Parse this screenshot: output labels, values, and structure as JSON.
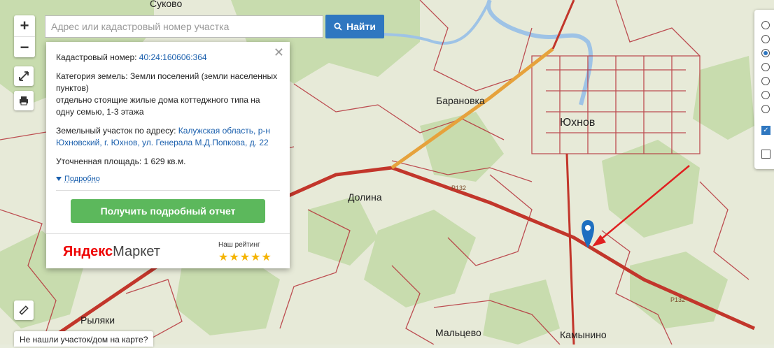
{
  "search": {
    "placeholder": "Адрес или кадастровый номер участка",
    "button_label": "Найти"
  },
  "zoom": {
    "plus": "+",
    "minus": "−"
  },
  "panel": {
    "cad_label": "Кадастровый номер:",
    "cad_number": "40:24:160606:364",
    "category_label": "Категория земель:",
    "category_value": "Земли поселений (земли населенных пунктов)",
    "use_value": "отдельно стоящие жилые дома коттеджного типа на одну семью, 1-3 этажа",
    "address_label": "Земельный участок по адресу:",
    "address_value": "Калужская область, р-н Юхновский, г. Юхнов, ул. Генерала М.Д.Попкова, д. 22",
    "area_label": "Уточненная площадь:",
    "area_value": "1 629 кв.м.",
    "more_label": "Подробно",
    "report_button": "Получить подробный отчет",
    "market_logo_red": "Яндекс",
    "market_logo_grey": "Маркет",
    "rating_label": "Наш рейтинг",
    "stars": "★★★★★"
  },
  "map_labels": {
    "barannovka": "Барановка",
    "yukhnov": "Юхнов",
    "dolina": "Долина",
    "malcevo": "Мальцево",
    "kamynino": "Камынино",
    "ryljaki": "Рыляки",
    "sukovo": "Суково",
    "road_a": "Р132",
    "road_b": "Р132"
  },
  "layers": {
    "radios": [
      false,
      false,
      true,
      false,
      false,
      false,
      false
    ],
    "checks": [
      true,
      false
    ]
  },
  "footer": {
    "not_found": "Не нашли участок/дом на карте?"
  },
  "colors": {
    "accent": "#2f77c0",
    "green_button": "#5cb85c",
    "boundary": "#b22222",
    "marker": "#1e6fc0",
    "arrow": "#e02020"
  }
}
